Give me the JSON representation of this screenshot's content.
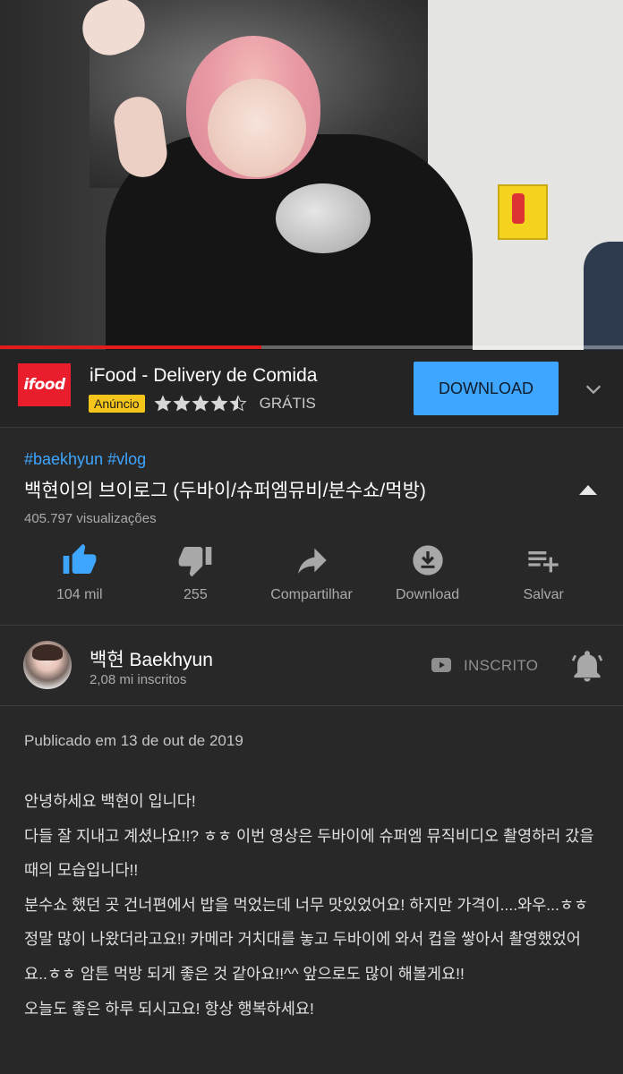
{
  "video": {
    "progress_percent": 42,
    "progress_color": "#e21b1b"
  },
  "ad": {
    "logo_text": "ifood",
    "title": "iFood - Delivery de Comida",
    "badge": "Anúncio",
    "rating": 4.5,
    "price": "GRÁTIS",
    "button": "DOWNLOAD",
    "brand_color": "#ea1d2c",
    "button_color": "#3ea6ff"
  },
  "info": {
    "tags": "#baekhyun #vlog",
    "title": "백현이의 브이로그 (두바이/슈퍼엠뮤비/분수쇼/먹방)",
    "views": "405.797 visualizações"
  },
  "actions": [
    {
      "icon": "thumbs-up-icon",
      "label": "104 mil"
    },
    {
      "icon": "thumbs-down-icon",
      "label": "255"
    },
    {
      "icon": "share-icon",
      "label": "Compartilhar"
    },
    {
      "icon": "download-icon",
      "label": "Download"
    },
    {
      "icon": "playlist-add-icon",
      "label": "Salvar"
    }
  ],
  "channel": {
    "name": "백현 Baekhyun",
    "subscribers": "2,08 mi inscritos",
    "subscribed_label": "INSCRITO"
  },
  "description": {
    "published": "Publicado em 13 de out de 2019",
    "lines": [
      "안녕하세요 백현이 입니다!",
      "다들 잘 지내고 계셨나요!!? ㅎㅎ 이번 영상은 두바이에 슈퍼엠 뮤직비디오 촬영하러 갔을 때의 모습입니다!!",
      "분수쇼 했던 곳 건너편에서 밥을 먹었는데 너무 맛있었어요! 하지만 가격이....와우...ㅎㅎ 정말 많이 나왔더라고요!! 카메라 거치대를 놓고 두바이에 와서 컵을 쌓아서 촬영했었어요..ㅎㅎ 암튼 먹방 되게 좋은 것 같아요!!^^ 앞으로도 많이 해볼게요!!",
      "오늘도 좋은 하루 되시고요! 항상 행복하세요!"
    ]
  }
}
